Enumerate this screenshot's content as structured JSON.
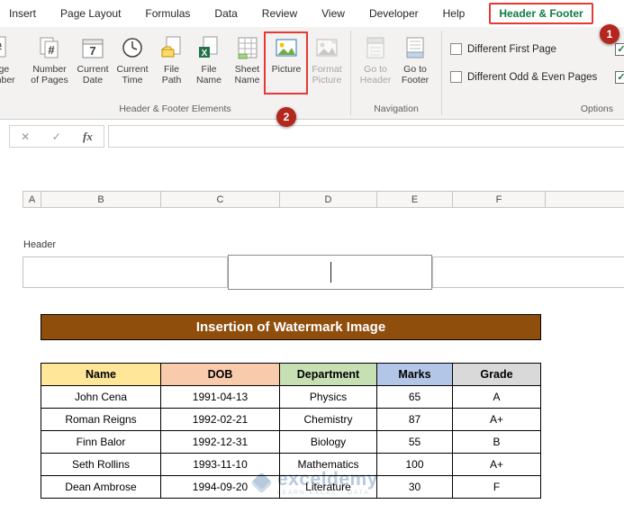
{
  "tabs": {
    "items": [
      "Insert",
      "Page Layout",
      "Formulas",
      "Data",
      "Review",
      "View",
      "Developer",
      "Help"
    ],
    "active": "Header & Footer"
  },
  "annotations": {
    "step1": "1",
    "step2": "2",
    "highlight_color": "#e53935",
    "badge_color": "#b3271e"
  },
  "ribbon": {
    "groups": {
      "elements": {
        "label": "Header & Footer Elements",
        "buttons": {
          "page_number": {
            "line1": "Page",
            "line2": "Number"
          },
          "number_of_pages": {
            "line1": "Number",
            "line2": "of Pages"
          },
          "current_date": {
            "line1": "Current",
            "line2": "Date"
          },
          "current_time": {
            "line1": "Current",
            "line2": "Time"
          },
          "file_path": {
            "line1": "File",
            "line2": "Path"
          },
          "file_name": {
            "line1": "File",
            "line2": "Name"
          },
          "sheet_name": {
            "line1": "Sheet",
            "line2": "Name"
          },
          "picture": {
            "line1": "Picture",
            "line2": ""
          },
          "format_picture": {
            "line1": "Format",
            "line2": "Picture"
          }
        }
      },
      "navigation": {
        "label": "Navigation",
        "buttons": {
          "go_to_header": {
            "line1": "Go to",
            "line2": "Header"
          },
          "go_to_footer": {
            "line1": "Go to",
            "line2": "Footer"
          }
        }
      },
      "options": {
        "label": "Options",
        "checkboxes": [
          {
            "label": "Different First Page",
            "checked": false
          },
          {
            "label": "Different Odd & Even Pages",
            "checked": false
          }
        ]
      }
    }
  },
  "formula_bar": {
    "cancel": "✕",
    "enter": "✓",
    "fx": "fx"
  },
  "columns": [
    "A",
    "B",
    "C",
    "D",
    "E",
    "F"
  ],
  "header_section": {
    "label": "Header"
  },
  "sheet": {
    "title": "Insertion of Watermark Image",
    "title_bg": "#904e0d",
    "table": {
      "headers": [
        "Name",
        "DOB",
        "Department",
        "Marks",
        "Grade"
      ],
      "header_colors": [
        "#ffe699",
        "#f8cbad",
        "#c6e0b4",
        "#b4c6e7",
        "#d9d9d9"
      ],
      "rows": [
        [
          "John Cena",
          "1991-04-13",
          "Physics",
          "65",
          "A"
        ],
        [
          "Roman Reigns",
          "1992-02-21",
          "Chemistry",
          "87",
          "A+"
        ],
        [
          "Finn Balor",
          "1992-12-31",
          "Biology",
          "55",
          "B"
        ],
        [
          "Seth Rollins",
          "1993-11-10",
          "Mathematics",
          "100",
          "A+"
        ],
        [
          "Dean Ambrose",
          "1994-09-20",
          "Literature",
          "30",
          "F"
        ]
      ]
    },
    "watermark": {
      "brand": "exceldemy",
      "tagline": "LEARN EXCEL - DATA"
    }
  }
}
